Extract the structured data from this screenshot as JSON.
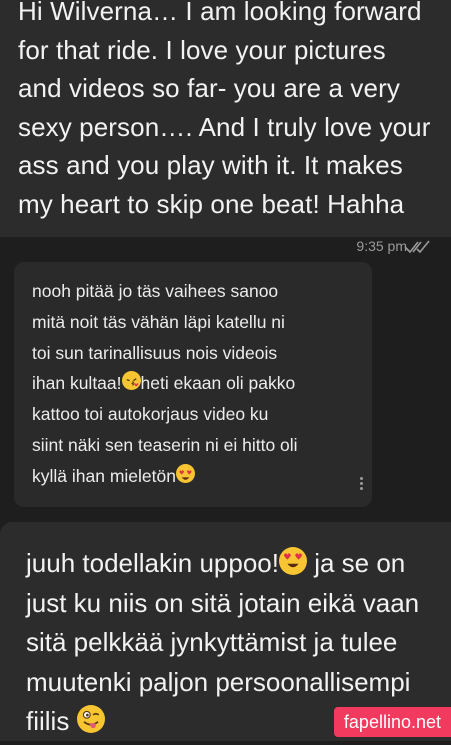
{
  "messages": {
    "m1": {
      "text": "Hi Wilverna… I am looking forward\nfor that ride. I love your pictures\nand videos so far- you are a very\nsexy person…. And I truly love your\nass and you play with it. It makes\nmy heart to skip one beat! Hahha",
      "time": "9:35 pm"
    },
    "m2": {
      "line1": "nooh pitää jo täs vaihees sanoo",
      "line2": "mitä noit täs vähän läpi katellu ni",
      "line3": "toi sun tarinallisuus nois videois",
      "line4a": "ihan kultaa!",
      "line4b": "heti ekaan oli pakko",
      "line5": "kattoo toi autokorjaus video ku",
      "line6": "siint näki sen teaserin ni ei hitto oli",
      "line7": "kyllä ihan mieletön"
    },
    "m3": {
      "line1a": "juuh todellakin uppoo!",
      "line1b": " ja se on",
      "line2": "just ku niis on sitä jotain eikä vaan",
      "line3": "sitä pelkkää jynkyttämist ja tulee",
      "line4": "muutenki paljon persoonallisempi",
      "line5": "fiilis "
    }
  },
  "icons": {
    "emoji_kiss": "face-blowing-kiss",
    "emoji_heart_eyes": "smiling-face-heart-eyes",
    "emoji_winking_tongue": "winking-face-tongue",
    "read_ticks": "double-check-icon",
    "more": "more-vertical-icon"
  },
  "watermark": "fapellino.net",
  "colors": {
    "outgoing_bg": "#2c2c2c",
    "incoming_bg": "#2a2a2a",
    "background": "#1e1e1e",
    "watermark": "#f2395e"
  }
}
